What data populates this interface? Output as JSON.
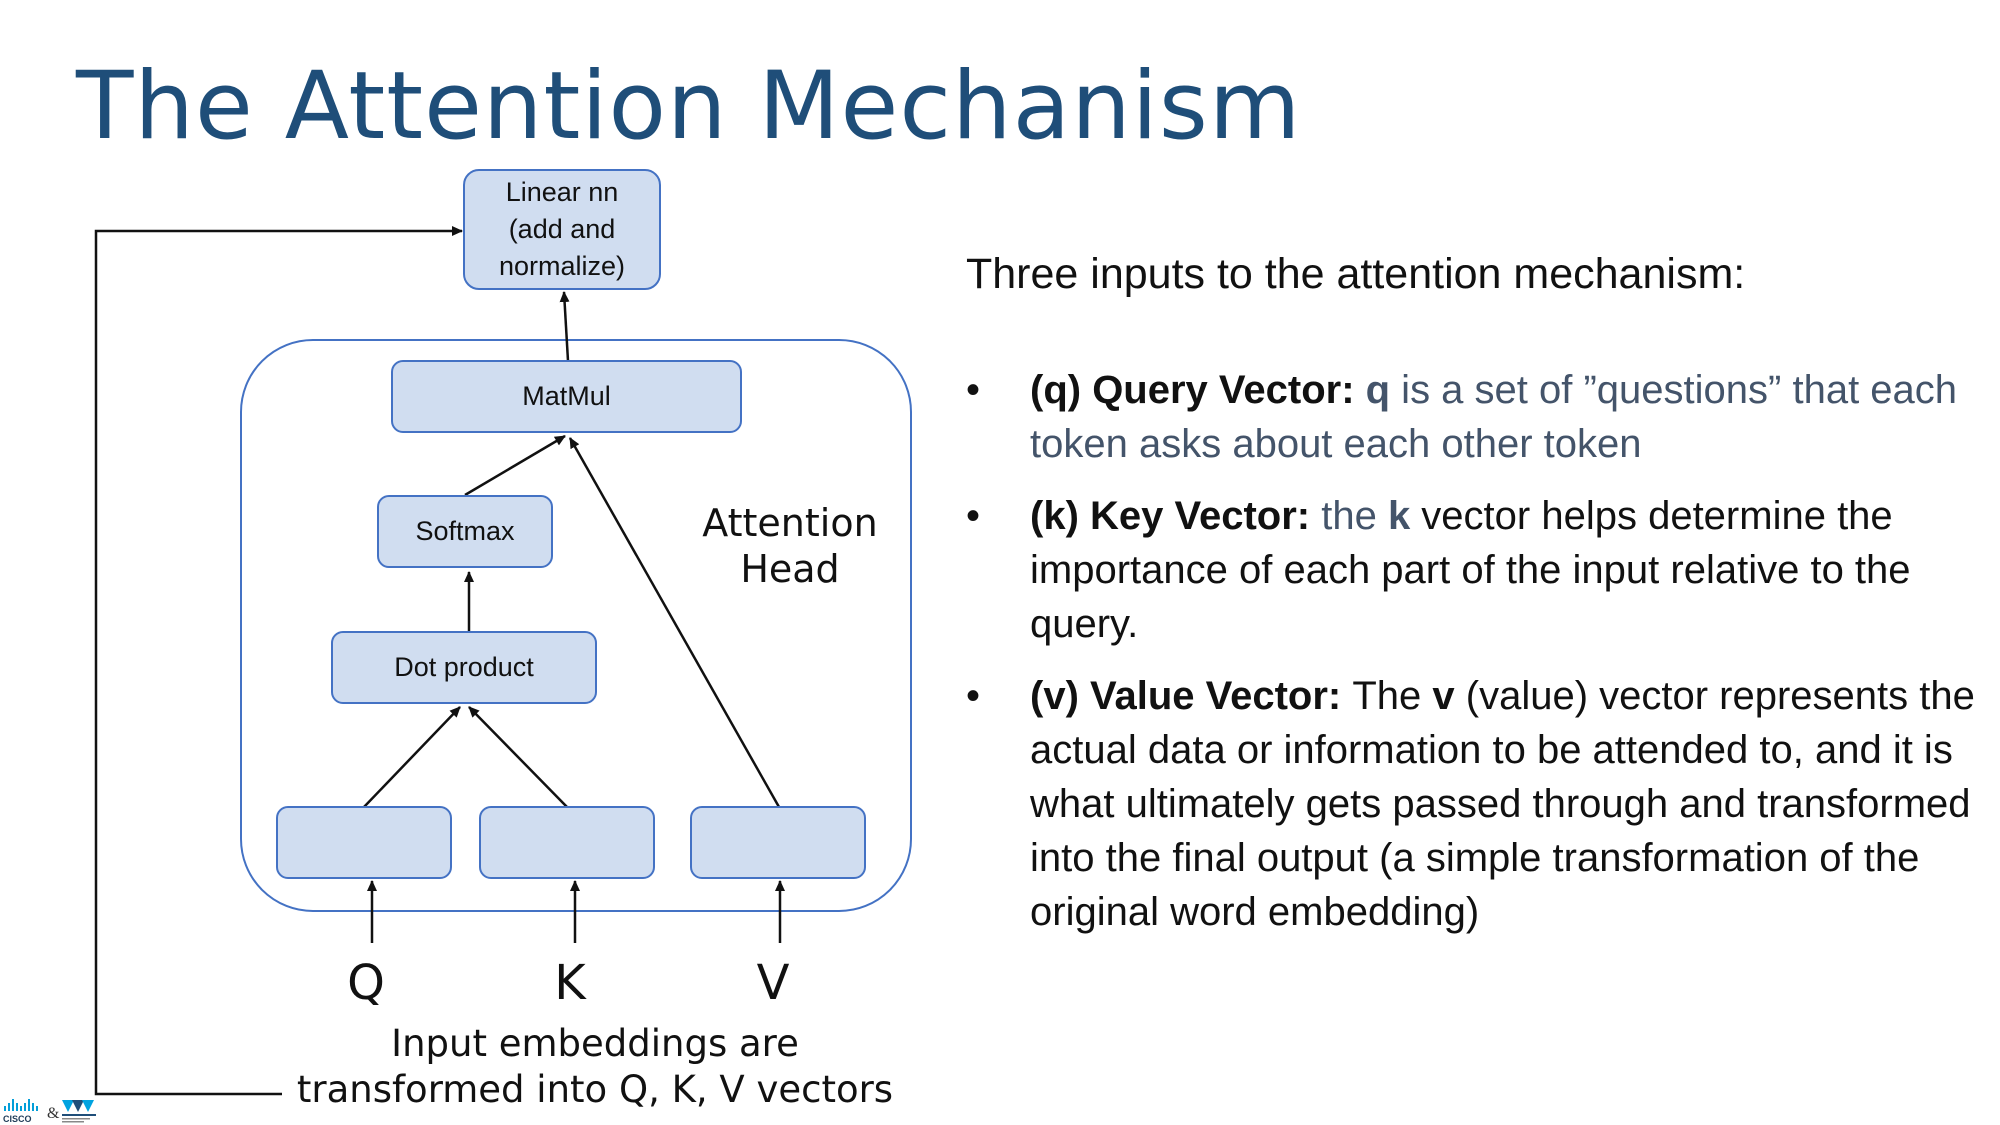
{
  "slide": {
    "title": "The Attention Mechanism"
  },
  "diagram": {
    "linear_box": "Linear nn\n(add and\nnormalize)",
    "matmul_box": "MatMul",
    "softmax_box": "Softmax",
    "dot_product_box": "Dot product",
    "attention_head_label": "Attention\nHead",
    "inputs": {
      "q": "Q",
      "k": "K",
      "v": "V"
    },
    "caption": "Input embeddings are\ntransformed into Q, K, V vectors"
  },
  "explanation": {
    "heading": "Three inputs to the attention mechanism:",
    "bullet_glyph": "•",
    "items": [
      {
        "lead": "(q) Query Vector: ",
        "var": "q",
        "rest": " is a set of ”questions” that each token asks about each other token"
      },
      {
        "lead": "(k) Key Vector: ",
        "pre": "the ",
        "var": "k",
        "rest": " vector helps determine the importance of each part of the input relative to the query."
      },
      {
        "lead": "(v) Value Vector: ",
        "pre": "The ",
        "var": "v",
        "rest": " (value) vector represents the actual data or information to be attended to, and it is what ultimately gets passed through and transformed into the final output (a simple transformation of the original word embedding)"
      }
    ]
  },
  "logo": {
    "left_word": "CISCO",
    "separator": "&",
    "right_word": "IMT",
    "right_subtitle": "IMT Atlantique"
  },
  "colors": {
    "title": "#1f4e79",
    "box_fill": "#d0ddf0",
    "box_border": "#4472c4",
    "muted_text": "#44546a",
    "cisco_blue": "#049fd9"
  }
}
